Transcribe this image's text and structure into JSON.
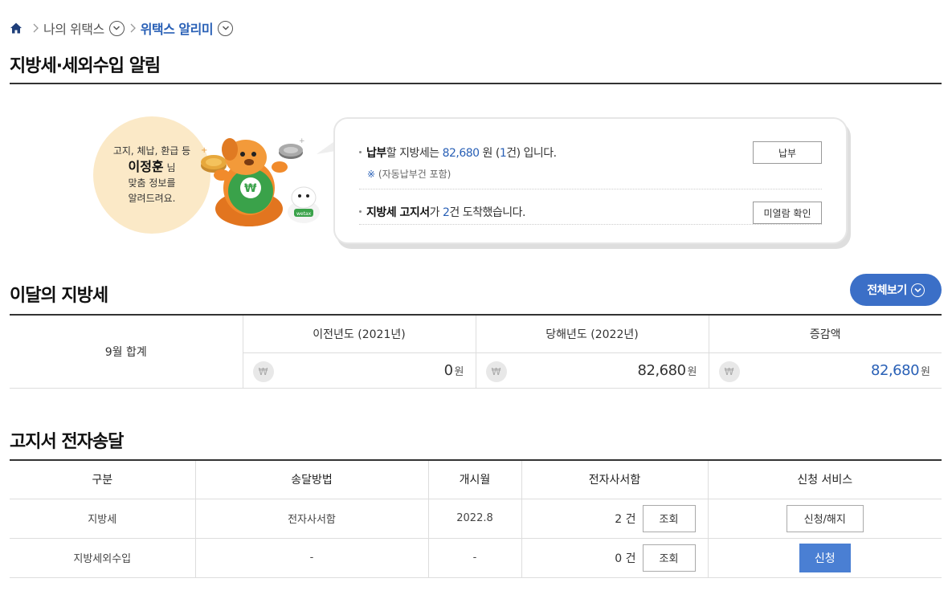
{
  "breadcrumb": {
    "item1": "나의 위택스",
    "item2": "위택스 알리미"
  },
  "page_title": "지방세·세외수입 알림",
  "notice": {
    "circle_line1": "고지, 체납, 환급 등",
    "user_name": "이정훈",
    "user_suffix": "님",
    "circle_line3": "맞춤 정보를",
    "circle_line4": "알려드려요.",
    "row1": {
      "bold": "납부",
      "t1": "할 지방세는 ",
      "amount": "82,680",
      "t2": " 원 (",
      "count": "1",
      "t3": "건) 입니다.",
      "sub_mark": "※",
      "sub_text": "(자동납부건 포함)",
      "button": "납부"
    },
    "row2": {
      "bold": "지방세 고지서",
      "t1": "가 ",
      "count": "2",
      "t2": "건 도착했습니다.",
      "button": "미열람 확인"
    }
  },
  "month_section": {
    "title": "이달의 지방세",
    "view_all": "전체보기",
    "row_label": "9월 합계",
    "columns": [
      "이전년도 (2021년)",
      "당해년도 (2022년)",
      "증감액"
    ],
    "currency_symbol": "₩",
    "unit": "원",
    "values": [
      "0",
      "82,680",
      "82,680"
    ]
  },
  "delivery_section": {
    "title": "고지서 전자송달",
    "headers": [
      "구분",
      "송달방법",
      "개시월",
      "전자사서함",
      "신청 서비스"
    ],
    "count_unit": "건",
    "query_label": "조회",
    "rows": [
      {
        "type": "지방세",
        "method": "전자사서함",
        "start": "2022.8",
        "count": "2",
        "service": "신청/해지"
      },
      {
        "type": "지방세외수입",
        "method": "-",
        "start": "-",
        "count": "0",
        "service": "신청"
      }
    ]
  },
  "colors": {
    "accent": "#2960b6",
    "button_blue": "#3b6fc7",
    "circle_bg": "#fbe9c7"
  }
}
